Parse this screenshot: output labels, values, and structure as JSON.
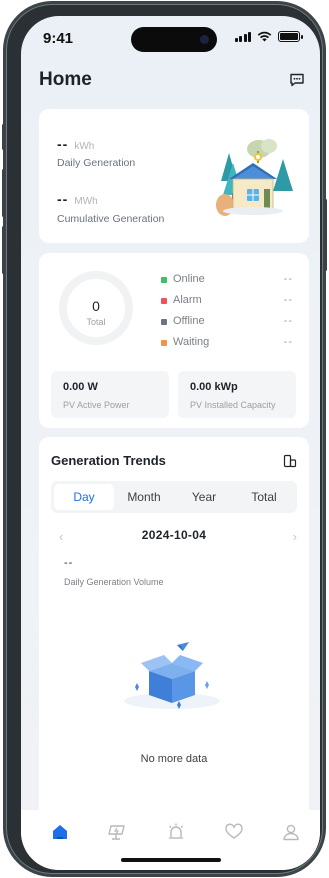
{
  "status_bar": {
    "time": "9:41"
  },
  "header": {
    "title": "Home"
  },
  "generation": {
    "daily_value": "--",
    "daily_unit": "kWh",
    "daily_label": "Daily Generation",
    "cumulative_value": "--",
    "cumulative_unit": "MWh",
    "cumulative_label": "Cumulative Generation"
  },
  "plant_status": {
    "total_value": "0",
    "total_label": "Total",
    "legend": [
      {
        "label": "Online",
        "value": "--",
        "color": "#3ebd6b"
      },
      {
        "label": "Alarm",
        "value": "--",
        "color": "#f0525b"
      },
      {
        "label": "Offline",
        "value": "--",
        "color": "#6b7385"
      },
      {
        "label": "Waiting",
        "value": "--",
        "color": "#f39244"
      }
    ],
    "pv_active_power_value": "0.00 W",
    "pv_active_power_label": "PV Active Power",
    "pv_installed_capacity_value": "0.00 kWp",
    "pv_installed_capacity_label": "PV Installed Capacity"
  },
  "trends": {
    "title": "Generation Trends",
    "tabs": [
      "Day",
      "Month",
      "Year",
      "Total"
    ],
    "active_tab": "Day",
    "date": "2024-10-04",
    "prev_symbol": "‹",
    "next_symbol": "›",
    "volume_value": "--",
    "volume_label": "Daily Generation Volume",
    "empty_text": "No more data"
  },
  "tab_bar": {
    "items": [
      {
        "icon": "home-icon",
        "active": true
      },
      {
        "icon": "power-station-icon",
        "active": false
      },
      {
        "icon": "alarm-icon",
        "active": false
      },
      {
        "icon": "service-heart-icon",
        "active": false
      },
      {
        "icon": "profile-icon",
        "active": false
      }
    ],
    "active_color": "#1e6fe8",
    "inactive_color": "#b4b9bf"
  },
  "colors": {
    "accent": "#1e6fe8",
    "text_primary": "#1f2329",
    "text_secondary": "#7b8088"
  }
}
